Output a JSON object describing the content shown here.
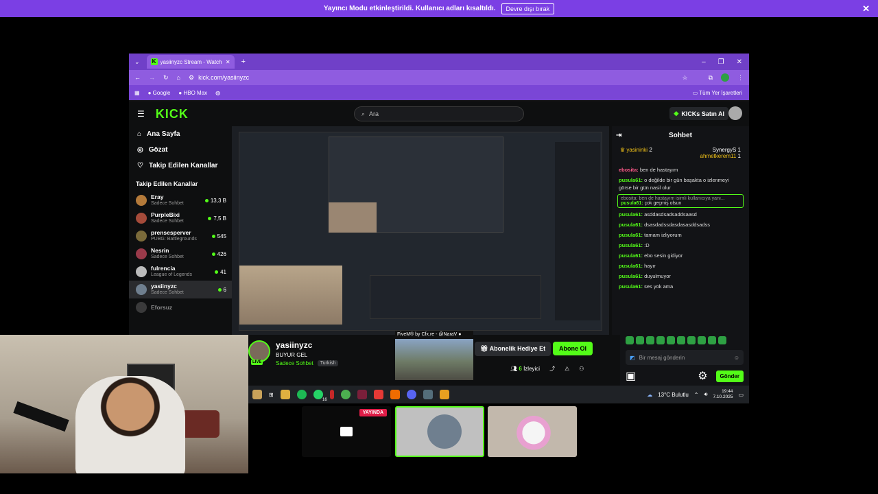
{
  "banner": {
    "text": "Yayıncı Modu etkinleştirildi. Kullanıcı adları kısaltıldı.",
    "button": "Devre dışı bırak"
  },
  "browser": {
    "tab_title": "yasiinyzc Stream - Watch Li",
    "url": "kick.com/yasiinyzc",
    "bookmarks": [
      "Google",
      "HBO Max"
    ],
    "all_bookmarks": "Tüm Yer İşaretleri"
  },
  "kick": {
    "logo": "KICK",
    "search_placeholder": "Ara",
    "kicks_button": "KICKs Satın Al",
    "nav": [
      {
        "label": "Ana Sayfa",
        "icon": "home-icon"
      },
      {
        "label": "Gözat",
        "icon": "browse-icon"
      },
      {
        "label": "Takip Edilen Kanallar",
        "icon": "heart-icon"
      }
    ],
    "followed_title": "Takip Edilen Kanallar",
    "channels": [
      {
        "name": "Eray",
        "sub": "Sadece Sohbet",
        "viewers": "13,3 B"
      },
      {
        "name": "PurpleBixi",
        "sub": "Sadece Sohbet",
        "viewers": "7,5 B"
      },
      {
        "name": "prensesperver",
        "sub": "PUBG: Battlegrounds",
        "viewers": "545"
      },
      {
        "name": "Nesrin",
        "sub": "Sadece Sohbet",
        "viewers": "426"
      },
      {
        "name": "fulrencia",
        "sub": "League of Legends",
        "viewers": "41"
      },
      {
        "name": "yasiinyzc",
        "sub": "Sadece Sohbet",
        "viewers": "6"
      },
      {
        "name": "Eforsuz",
        "sub": "",
        "viewers": ""
      }
    ]
  },
  "chat": {
    "title": "Sohbet",
    "leaderboard": [
      {
        "name": "yasininki",
        "n": "2"
      },
      {
        "name": "SynergyS",
        "n": "1"
      },
      {
        "name": "ahmetkerem11",
        "n": "1"
      }
    ],
    "messages": [
      {
        "user": "ebosita:",
        "text": "ben de hastayım"
      },
      {
        "user": "pusula61:",
        "text": "o değilde bir gün başakta o izlenmeyi görse bir gün nasil olur"
      }
    ],
    "reply": {
      "quote": "ebosita: ben de hastayım isimli kullanıcıya yanı...",
      "user": "pusula61:",
      "text": "çok geçmiş olsun"
    },
    "messages2": [
      {
        "user": "pusula61:",
        "text": "asddasdsadsaddsaasd"
      },
      {
        "user": "pusula61:",
        "text": "dsasdadssdasdasasddsadss"
      },
      {
        "user": "pusula61:",
        "text": "tamam izliyorum"
      },
      {
        "user": "pusula61:",
        "text": ":D"
      },
      {
        "user": "pusula61:",
        "text": "ebo sesin gidiyor"
      },
      {
        "user": "pusula61:",
        "text": "hayır"
      },
      {
        "user": "pusula61:",
        "text": "duyulmuyor"
      },
      {
        "user": "pusula61:",
        "text": "ses yok ama"
      }
    ],
    "input_placeholder": "Bir mesaj gönderin",
    "send": "Gönder"
  },
  "stream": {
    "name": "yasiinyzc",
    "title": "BUYUR GEL",
    "category": "Sadece Sohbet",
    "tag": "Turkish",
    "live": "LIVE",
    "gift": "Abonelik Hediye Et",
    "subscribe": "Abone Ol",
    "viewers_count": "6",
    "viewers_label": "İzleyici",
    "preview_title": "FiveM® by Cfx.re - @NaraV ●"
  },
  "taskbar": {
    "weather": "13°C Bulutlu",
    "time": "19:44",
    "date": "7.10.2025",
    "whatsapp_badge": "16"
  },
  "tiles": {
    "live_badge": "YAYINDA"
  }
}
